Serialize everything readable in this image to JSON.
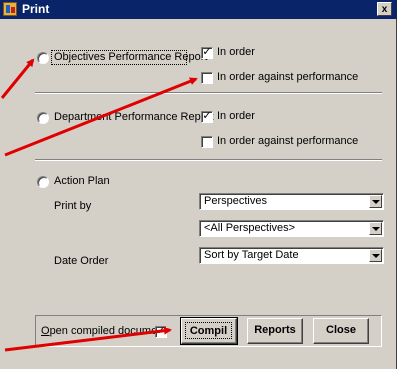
{
  "window": {
    "title": "Print",
    "close_glyph": "x"
  },
  "objectives": {
    "radio_label": "Objectives Performance Report",
    "in_order_checked": true,
    "in_order_label": "In order",
    "against_checked": false,
    "against_label": "In order against performance"
  },
  "department": {
    "radio_label": "Department Performance Report",
    "in_order_checked": true,
    "in_order_label": "In order",
    "against_checked": false,
    "against_label": "In order against performance"
  },
  "action_plan": {
    "radio_label": "Action Plan",
    "print_by_label": "Print by",
    "print_by_value": "Perspectives",
    "filter_value": "<All Perspectives>",
    "date_order_label": "Date Order",
    "date_order_value": "Sort by Target Date"
  },
  "footer": {
    "open_compiled_label": "Open compiled document",
    "open_compiled_checked": true,
    "compil_button": "Compil",
    "reports_button": "Reports",
    "close_button": "Close"
  },
  "colors": {
    "titlebar": "#0a246a",
    "dialog_face": "#d4d0c8",
    "annotation_arrow": "#e00000"
  },
  "icons": {
    "app": "print-app-icon",
    "close": "close-icon",
    "dropdown": "chevron-down-icon",
    "check": "checkmark-icon"
  }
}
